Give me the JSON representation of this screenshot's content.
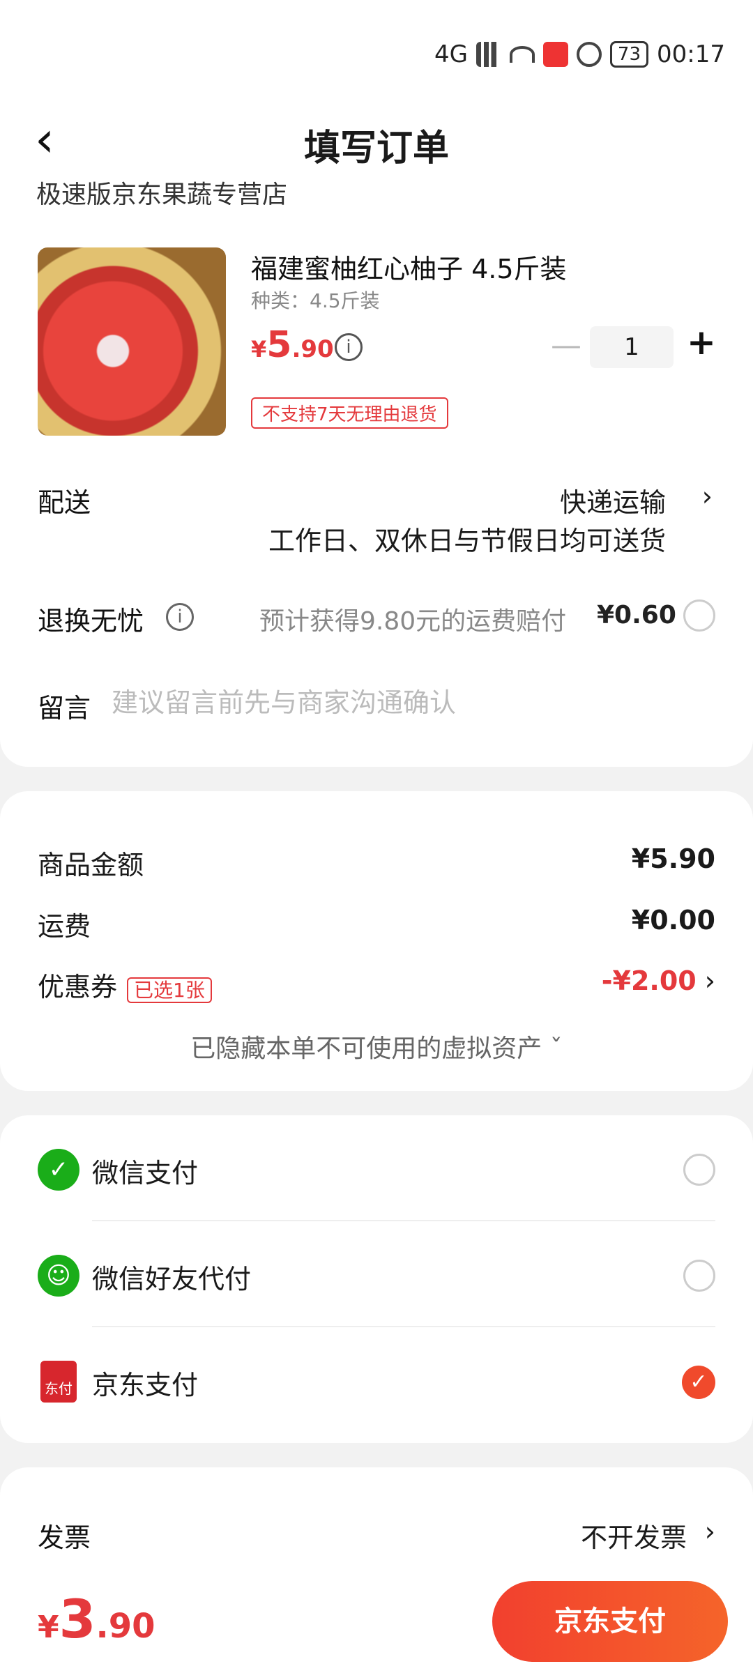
{
  "status_bar": {
    "time": "00:17",
    "battery": "73",
    "network": "4G"
  },
  "header": {
    "title": "填写订单"
  },
  "store": {
    "name": "极速版京东果蔬专营店"
  },
  "product": {
    "name": "福建蜜柚红心柚子 4.5斤装",
    "spec": "种类：4.5斤装",
    "price_currency": "¥",
    "price_int": "5",
    "price_dec": ".90",
    "quantity": "1",
    "return_tag": "不支持7天无理由退货"
  },
  "delivery": {
    "label": "配送",
    "method": "快递运输",
    "note": "工作日、双休日与节假日均可送货"
  },
  "return_care": {
    "label": "退换无忧",
    "desc": "预计获得9.80元的运费赔付",
    "fee": "¥0.60"
  },
  "message": {
    "label": "留言",
    "placeholder": "建议留言前先与商家沟通确认"
  },
  "summary": {
    "goods_label": "商品金额",
    "goods_value": "¥5.90",
    "shipping_label": "运费",
    "shipping_value": "¥0.00",
    "coupon_label": "优惠券",
    "coupon_tag": "已选1张",
    "coupon_value": "-¥2.00",
    "hidden_note": "已隐藏本单不可使用的虚拟资产"
  },
  "payment": {
    "options": [
      {
        "label": "微信支付",
        "selected": false
      },
      {
        "label": "微信好友代付",
        "selected": false
      },
      {
        "label": "京东支付",
        "selected": true
      }
    ],
    "jd_icon_text": "东付"
  },
  "invoice": {
    "label": "发票",
    "value": "不开发票"
  },
  "footer": {
    "currency": "¥",
    "total_int": "3",
    "total_dec": ".90",
    "pay_button": "京东支付"
  },
  "colors": {
    "accent": "#e4393c",
    "wechat": "#1aad19",
    "button": "#f2402e"
  }
}
